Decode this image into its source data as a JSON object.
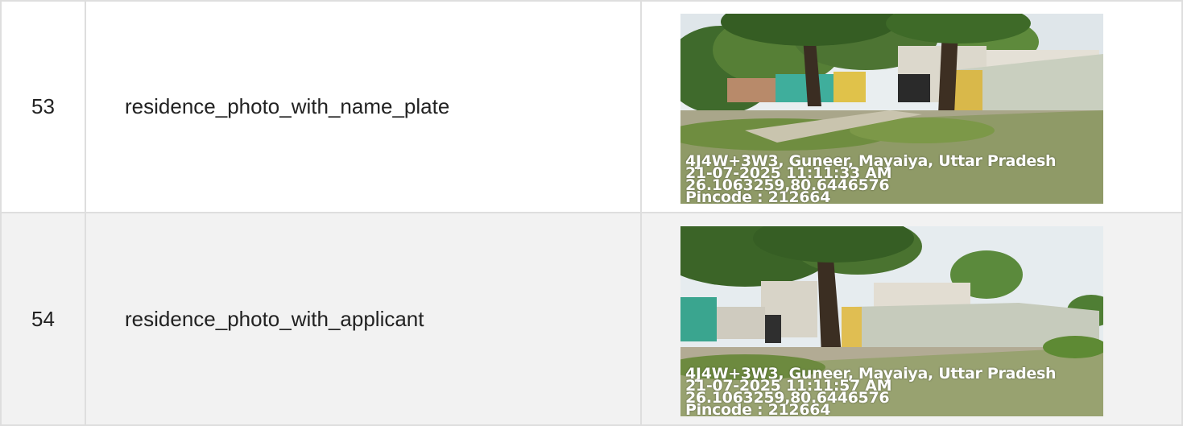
{
  "rows": [
    {
      "index": "53",
      "field": "residence_photo_with_name_plate",
      "stamp": {
        "address": "4J4W+3W3, Guneer, Mayaiya, Uttar Pradesh",
        "datetime": "21-07-2025 11:11:33 AM",
        "coords": "26.1063259,80.6446576",
        "pincode": "Pincode : 212664"
      }
    },
    {
      "index": "54",
      "field": "residence_photo_with_applicant",
      "stamp": {
        "address": "4J4W+3W3, Guneer, Mayaiya, Uttar Pradesh",
        "datetime": "21-07-2025 11:11:57 AM",
        "coords": "26.1063259,80.6446576",
        "pincode": "Pincode : 212664"
      }
    }
  ],
  "colors": {
    "border": "#dedede",
    "row_alt_bg": "#f2f2f2",
    "text": "#222222"
  }
}
